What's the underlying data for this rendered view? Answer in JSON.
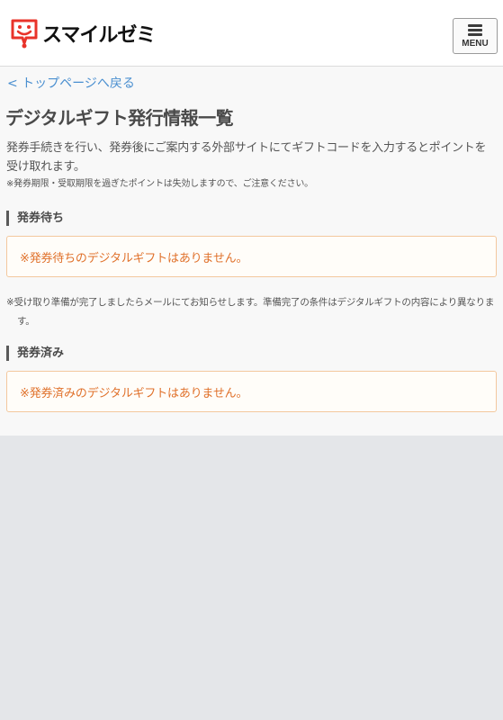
{
  "header": {
    "logo_text": "スマイルゼミ",
    "menu_label": "MENU"
  },
  "nav": {
    "back_link": "< トップページへ戻る"
  },
  "page": {
    "title": "デジタルギフト発行情報一覧",
    "intro": "発券手続きを行い、発券後にご案内する外部サイトにてギフトコードを入力するとポイントを受け取れます。",
    "note_expiry": "※発券期限・受取期限を過ぎたポイントは失効しますので、ご注意ください。"
  },
  "sections": {
    "pending": {
      "heading": "発券待ち",
      "empty_message": "※発券待ちのデジタルギフトはありません。"
    },
    "note_ready": "※受け取り準備が完了しましたらメールにてお知らせします。準備完了の条件はデジタルギフトの内容により異なります。",
    "issued": {
      "heading": "発券済み",
      "empty_message": "※発券済みのデジタルギフトはありません。"
    }
  },
  "colors": {
    "link": "#4a8fd0",
    "notice_text": "#e0712b",
    "notice_border": "#f3c89e",
    "logo_red": "#e8332a"
  }
}
